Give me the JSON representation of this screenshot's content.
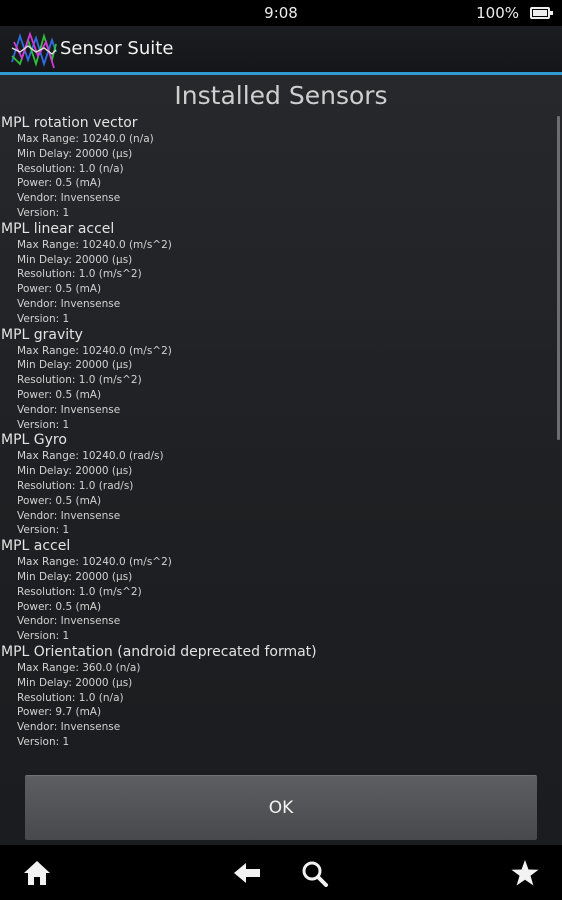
{
  "status_bar": {
    "time": "9:08",
    "battery": "100%"
  },
  "action_bar": {
    "app_title": "Sensor Suite"
  },
  "dialog": {
    "title": "Installed Sensors",
    "sensors": [
      {
        "name": "MPL rotation vector",
        "details": [
          "Max Range: 10240.0 (n/a)",
          "Min Delay: 20000 (µs)",
          "Resolution: 1.0 (n/a)",
          "Power: 0.5 (mA)",
          "Vendor: Invensense",
          "Version: 1"
        ]
      },
      {
        "name": "MPL linear accel",
        "details": [
          "Max Range: 10240.0 (m/s^2)",
          "Min Delay: 20000 (µs)",
          "Resolution: 1.0 (m/s^2)",
          "Power: 0.5 (mA)",
          "Vendor: Invensense",
          "Version: 1"
        ]
      },
      {
        "name": "MPL gravity",
        "details": [
          "Max Range: 10240.0 (m/s^2)",
          "Min Delay: 20000 (µs)",
          "Resolution: 1.0 (m/s^2)",
          "Power: 0.5 (mA)",
          "Vendor: Invensense",
          "Version: 1"
        ]
      },
      {
        "name": "MPL Gyro",
        "details": [
          "Max Range: 10240.0 (rad/s)",
          "Min Delay: 20000 (µs)",
          "Resolution: 1.0 (rad/s)",
          "Power: 0.5 (mA)",
          "Vendor: Invensense",
          "Version: 1"
        ]
      },
      {
        "name": "MPL accel",
        "details": [
          "Max Range: 10240.0 (m/s^2)",
          "Min Delay: 20000 (µs)",
          "Resolution: 1.0 (m/s^2)",
          "Power: 0.5 (mA)",
          "Vendor: Invensense",
          "Version: 1"
        ]
      },
      {
        "name": "MPL Orientation (android deprecated format)",
        "details": [
          "Max Range: 360.0 (n/a)",
          "Min Delay: 20000 (µs)",
          "Resolution: 1.0 (n/a)",
          "Power: 9.7 (mA)",
          "Vendor: Invensense",
          "Version: 1"
        ]
      }
    ],
    "ok_label": "OK"
  },
  "nav_bar": {
    "icons": [
      "home-icon",
      "back-icon",
      "search-icon",
      "star-icon"
    ]
  },
  "colors": {
    "accent": "#2f9bd1",
    "background": "#1d1f22",
    "button": "#535558"
  }
}
